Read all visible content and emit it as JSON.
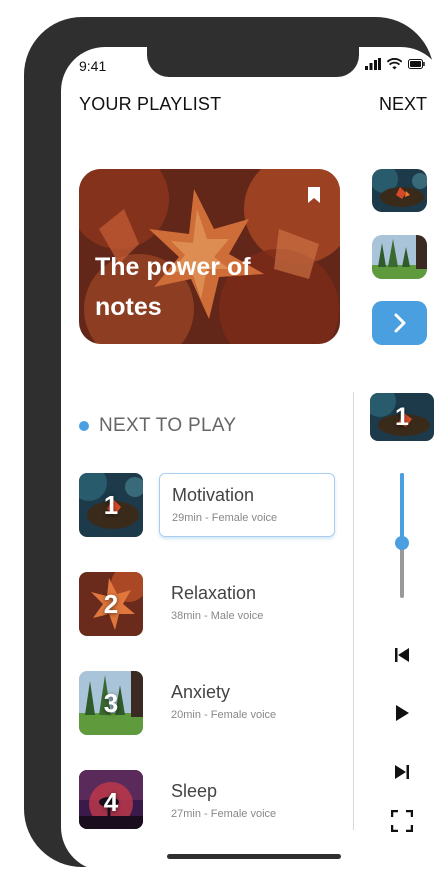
{
  "status": {
    "time": "9:41"
  },
  "header": {
    "title": "YOUR PLAYLIST",
    "next_label": "NEXT"
  },
  "hero": {
    "title": "The power of notes"
  },
  "section": {
    "label": "NEXT TO PLAY"
  },
  "tracks": [
    {
      "number": "1",
      "name": "Motivation",
      "meta": "29min - Female voice",
      "active": true
    },
    {
      "number": "2",
      "name": "Relaxation",
      "meta": "38min - Male voice"
    },
    {
      "number": "3",
      "name": "Anxiety",
      "meta": "20min - Female voice"
    },
    {
      "number": "4",
      "name": "Sleep",
      "meta": "27min - Female voice"
    }
  ],
  "now_playing": {
    "number": "1"
  },
  "volume": {
    "level_fraction": 0.56
  },
  "colors": {
    "accent": "#4a9fe0",
    "frame": "#2f2f2f"
  },
  "icons": [
    "signal-icon",
    "wifi-icon",
    "battery-icon",
    "bookmark-icon",
    "chevron-right-icon",
    "skip-previous-icon",
    "play-icon",
    "skip-next-icon",
    "fullscreen-icon"
  ]
}
